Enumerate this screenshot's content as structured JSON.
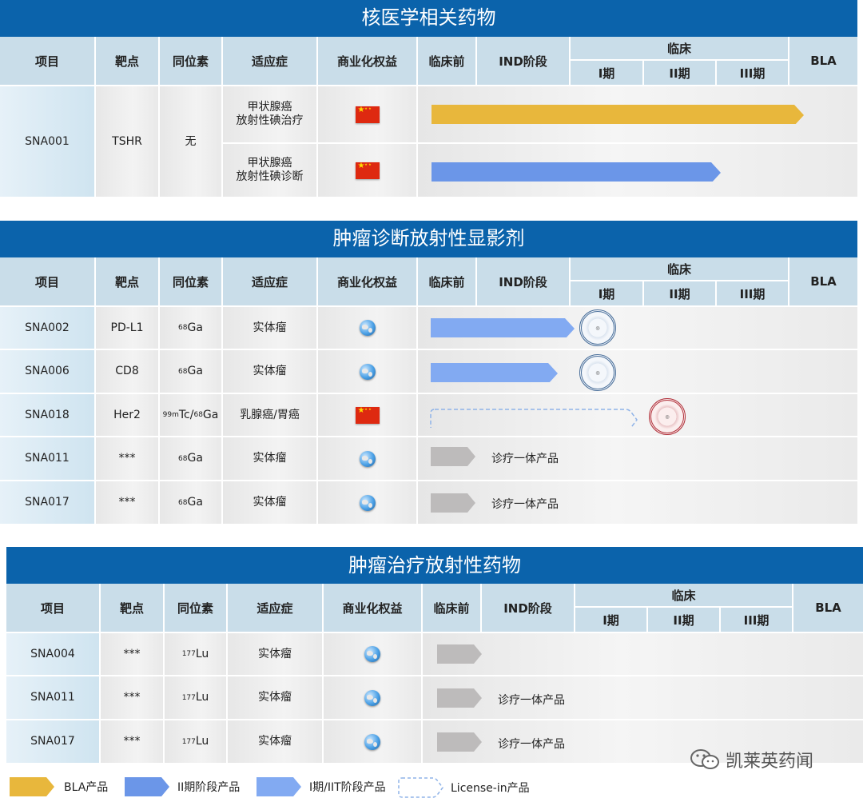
{
  "sections": [
    {
      "title": "核医学相关药物"
    },
    {
      "title": "肿瘤诊断放射性显影剂"
    },
    {
      "title": "肿瘤治疗放射性药物"
    }
  ],
  "headers": {
    "project": "项目",
    "target": "靶点",
    "isotope": "同位素",
    "indication": "适应症",
    "rights": "商业化权益",
    "preclinical": "临床前",
    "ind": "IND阶段",
    "clinical": "临床",
    "phase1": "I期",
    "phase2": "II期",
    "phase3": "III期",
    "bla": "BLA"
  },
  "s1": {
    "project": "SNA001",
    "target": "TSHR",
    "isotope": "无",
    "rows": [
      {
        "indication_l1": "甲状腺癌",
        "indication_l2": "放射性碘治疗",
        "rights": "china-flag",
        "stage": "BLA"
      },
      {
        "indication_l1": "甲状腺癌",
        "indication_l2": "放射性碘诊断",
        "rights": "china-flag",
        "stage": "II期"
      }
    ]
  },
  "s2": [
    {
      "project": "SNA002",
      "target": "PD-L1",
      "iso_mass": "68",
      "iso_el": "Ga",
      "indication": "实体瘤",
      "rights": "globe"
    },
    {
      "project": "SNA006",
      "target": "CD8",
      "iso_mass": "68",
      "iso_el": "Ga",
      "indication": "实体瘤",
      "rights": "globe"
    },
    {
      "project": "SNA018",
      "target": "Her2",
      "iso_mass": "99m",
      "iso_el": "Tc/",
      "iso_mass2": "68",
      "iso_el2": "Ga",
      "indication": "乳腺癌/胃癌",
      "rights": "china-flag"
    },
    {
      "project": "SNA011",
      "target": "***",
      "iso_mass": "68",
      "iso_el": "Ga",
      "indication": "实体瘤",
      "rights": "globe",
      "note": "诊疗一体产品"
    },
    {
      "project": "SNA017",
      "target": "***",
      "iso_mass": "68",
      "iso_el": "Ga",
      "indication": "实体瘤",
      "rights": "globe",
      "note": "诊疗一体产品"
    }
  ],
  "s3": [
    {
      "project": "SNA004",
      "target": "***",
      "iso_mass": "177",
      "iso_el": "Lu",
      "indication": "实体瘤",
      "rights": "globe",
      "note": ""
    },
    {
      "project": "SNA011",
      "target": "***",
      "iso_mass": "177",
      "iso_el": "Lu",
      "indication": "实体瘤",
      "rights": "globe",
      "note": "诊疗一体产品"
    },
    {
      "project": "SNA017",
      "target": "***",
      "iso_mass": "177",
      "iso_el": "Lu",
      "indication": "实体瘤",
      "rights": "globe",
      "note": "诊疗一体产品"
    }
  ],
  "legend": {
    "bla": "BLA产品",
    "phase2": "II期阶段产品",
    "phase1": "I期/IIT阶段产品",
    "license": "License-in产品"
  },
  "watermark": "凯莱英药闻",
  "colors": {
    "header_blue": "#0b63ab",
    "bla_gold": "#e8b73c",
    "phase2_blue": "#6b96e8",
    "phase1_blue": "#82aaf2",
    "preclinical_gray": "#bdbbbb"
  }
}
